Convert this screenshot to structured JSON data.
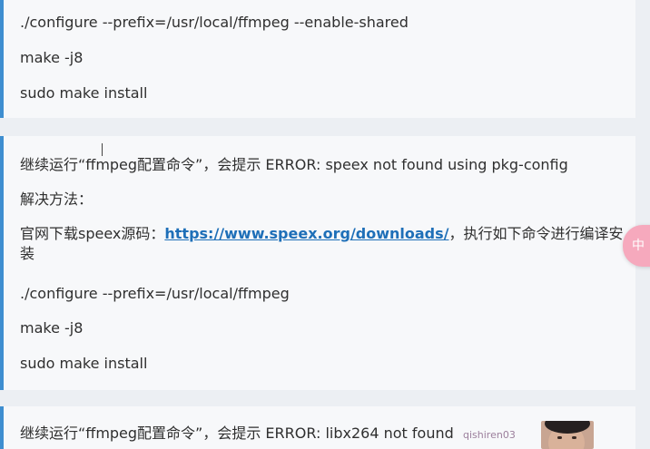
{
  "block1": {
    "lines": [
      "./configure --prefix=/usr/local/ffmpeg --enable-shared",
      "make -j8",
      "sudo make install"
    ]
  },
  "block2": {
    "intro": "继续运行“ffmpeg配置命令”，会提示 ERROR: speex not found using pkg-config",
    "solution_label": "解决方法：",
    "download_prefix": "官网下载speex源码：",
    "download_link": "https://www.speex.org/downloads/",
    "download_suffix": "，执行如下命令进行编译安装",
    "commands": [
      "./configure --prefix=/usr/local/ffmpeg",
      "make -j8",
      "sudo make install"
    ]
  },
  "block3": {
    "intro": "继续运行“ffmpeg配置命令”，会提示 ERROR: libx264 not found"
  },
  "overlay": {
    "float_button_text": "中",
    "watermark": "qishiren03"
  },
  "colors": {
    "accent_bar": "#3e8ed0",
    "link": "#1e6fb8",
    "float_button": "#f6a9bd"
  }
}
